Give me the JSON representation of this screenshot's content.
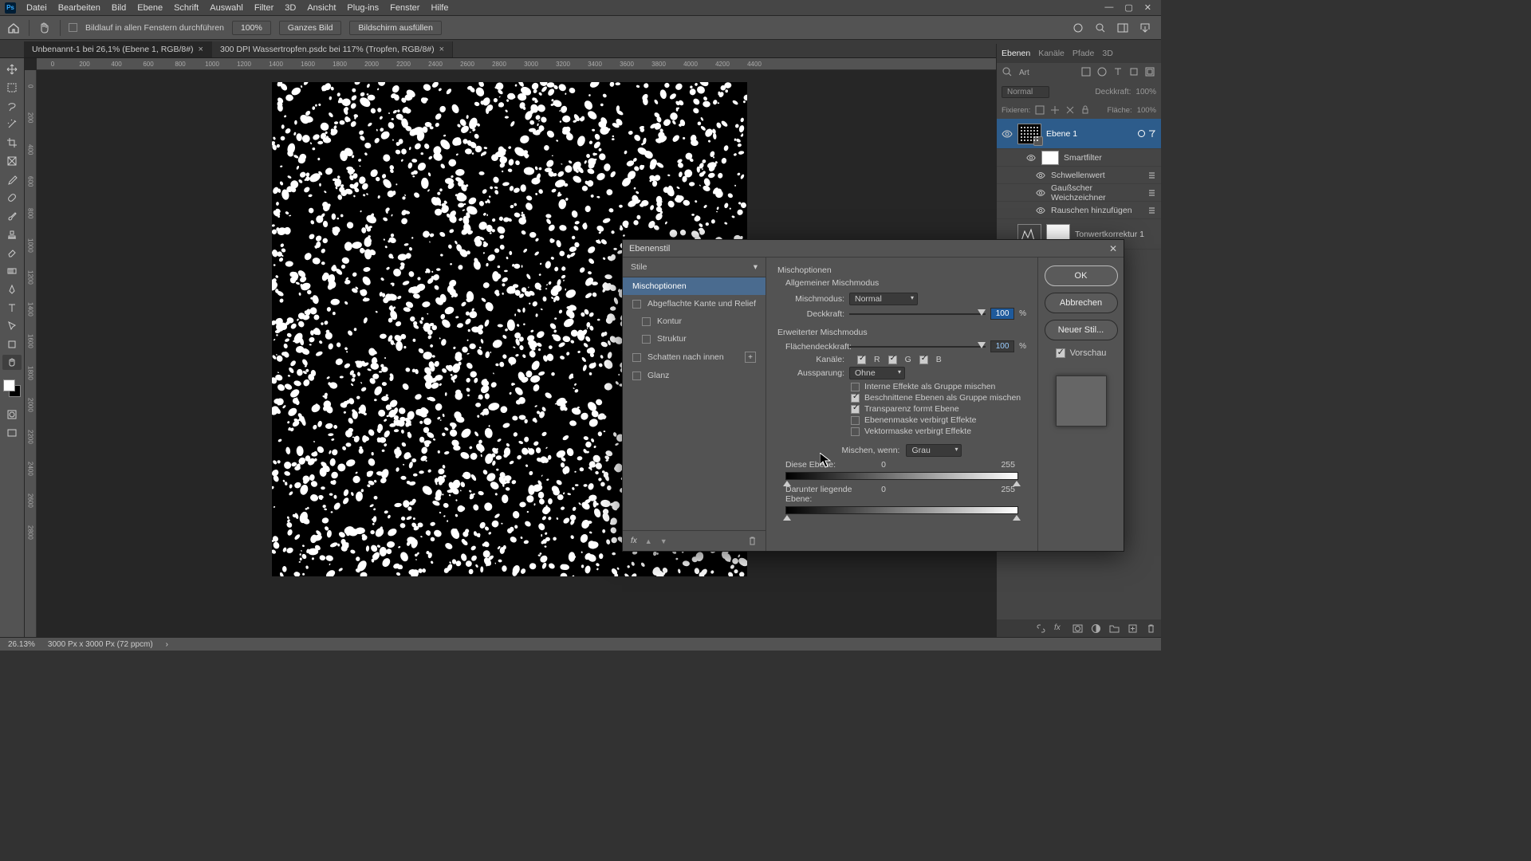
{
  "menubar": [
    "Datei",
    "Bearbeiten",
    "Bild",
    "Ebene",
    "Schrift",
    "Auswahl",
    "Filter",
    "3D",
    "Ansicht",
    "Plug-ins",
    "Fenster",
    "Hilfe"
  ],
  "optionsbar": {
    "scroll_all": "Bildlauf in allen Fenstern durchführen",
    "zoom": "100%",
    "fit_btn": "Ganzes Bild",
    "fill_btn": "Bildschirm ausfüllen"
  },
  "tabs": [
    {
      "label": "Unbenannt-1 bei 26,1% (Ebene 1, RGB/8#)",
      "active": true
    },
    {
      "label": "300 DPI Wassertropfen.psdc bei 117% (Tropfen, RGB/8#)",
      "active": false
    }
  ],
  "ruler_h": [
    "0",
    "200",
    "400",
    "600",
    "800",
    "1000",
    "1200",
    "1400",
    "1600",
    "1800",
    "2000",
    "2200",
    "2400",
    "2600",
    "2800",
    "3000",
    "3200",
    "3400",
    "3600",
    "3800",
    "4000",
    "4200",
    "4400"
  ],
  "ruler_v": [
    "0",
    "200",
    "400",
    "600",
    "800",
    "1000",
    "1200",
    "1400",
    "1600",
    "1800",
    "2000",
    "2200",
    "2400",
    "2600",
    "2800"
  ],
  "layers_panel": {
    "tabs": [
      "Ebenen",
      "Kanäle",
      "Pfade",
      "3D"
    ],
    "filter_label": "Art",
    "blend_mode": "Normal",
    "opacity_label": "Deckkraft:",
    "opacity_value": "100%",
    "lock_label": "Fixieren:",
    "fill_label": "Fläche:",
    "fill_value": "100%",
    "layers": [
      {
        "name": "Ebene 1",
        "selected": true,
        "thumb": "noise",
        "smart": true
      },
      {
        "name": "Smartfilter",
        "sub": 1,
        "thumb": "white"
      },
      {
        "name": "Schwellenwert",
        "sub": 2
      },
      {
        "name": "Gaußscher Weichzeichner",
        "sub": 2
      },
      {
        "name": "Rauschen hinzufügen",
        "sub": 2
      },
      {
        "name": "Tonwertkorrektur 1",
        "thumb": "adjust"
      }
    ]
  },
  "dialog": {
    "title": "Ebenenstil",
    "styles_header": "Stile",
    "styles": [
      {
        "label": "Mischoptionen",
        "active": true,
        "cb": null
      },
      {
        "label": "Abgeflachte Kante und Relief",
        "cb": false
      },
      {
        "label": "Kontur",
        "cb": false,
        "indent": true
      },
      {
        "label": "Struktur",
        "cb": false,
        "indent": true
      },
      {
        "label": "Schatten nach innen",
        "cb": false,
        "plus": true
      },
      {
        "label": "Glanz",
        "cb": false
      }
    ],
    "opts": {
      "section1": "Mischoptionen",
      "sub1": "Allgemeiner Mischmodus",
      "blendmode_label": "Mischmodus:",
      "blendmode_value": "Normal",
      "opacity_label": "Deckkraft:",
      "opacity_value": "100",
      "opacity_unit": "%",
      "section2": "Erweiterter Mischmodus",
      "fill_label": "Flächendeckkraft:",
      "fill_value": "100",
      "fill_unit": "%",
      "channels_label": "Kanäle:",
      "channels": [
        "R",
        "G",
        "B"
      ],
      "knockout_label": "Aussparung:",
      "knockout_value": "Ohne",
      "cb1": "Interne Effekte als Gruppe mischen",
      "cb2": "Beschnittene Ebenen als Gruppe mischen",
      "cb3": "Transparenz formt Ebene",
      "cb4": "Ebenenmaske verbirgt Effekte",
      "cb5": "Vektormaske verbirgt Effekte",
      "blendif_label": "Mischen, wenn:",
      "blendif_value": "Grau",
      "this_layer": "Diese Ebene:",
      "this_lo": "0",
      "this_hi": "255",
      "under_layer": "Darunter liegende Ebene:",
      "under_lo": "0",
      "under_hi": "255"
    },
    "buttons": {
      "ok": "OK",
      "cancel": "Abbrechen",
      "newstyle": "Neuer Stil...",
      "preview": "Vorschau"
    }
  },
  "statusbar": {
    "zoom": "26.13%",
    "docinfo": "3000 Px x 3000 Px (72 ppcm)"
  }
}
